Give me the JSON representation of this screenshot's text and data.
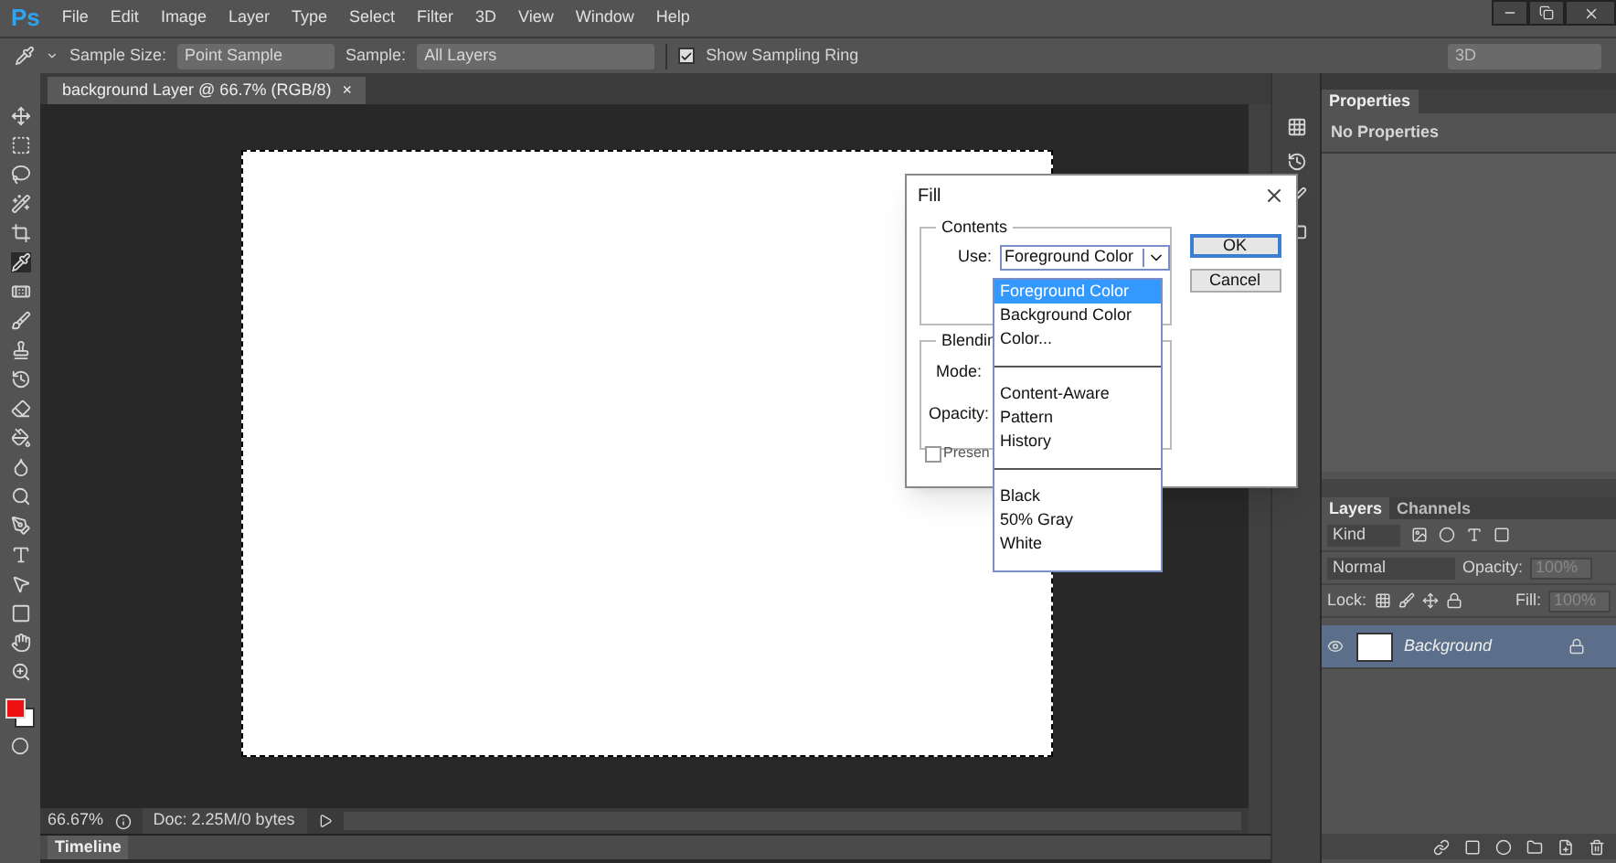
{
  "menu_bar": {
    "logo": "Ps",
    "items": [
      "File",
      "Edit",
      "Image",
      "Layer",
      "Type",
      "Select",
      "Filter",
      "3D",
      "View",
      "Window",
      "Help"
    ]
  },
  "options_bar": {
    "sample_size_label": "Sample Size:",
    "sample_size": "Point Sample",
    "sample_label": "Sample:",
    "sample": "All Layers",
    "show_sampling_ring": {
      "label": "Show Sampling Ring",
      "checked": true
    },
    "workspace": "3D"
  },
  "document": {
    "tab_title": "background Layer @ 66.7% (RGB/8)",
    "tab_close": "×"
  },
  "status_bar": {
    "zoom": "66.67%",
    "doc_info": "Doc: 2.25M/0 bytes"
  },
  "timeline": {
    "title": "Timeline"
  },
  "properties_panel": {
    "tab": "Properties",
    "message": "No Properties"
  },
  "layers_panel": {
    "tabs": [
      {
        "label": "Layers",
        "selected": true
      },
      {
        "label": "Channels",
        "selected": false
      }
    ],
    "filter": "Kind",
    "blend_mode": "Normal",
    "opacity_label": "Opacity:",
    "opacity": "100%",
    "lock_label": "Lock:",
    "fill_label": "Fill:",
    "fill": "100%",
    "layers": [
      {
        "name": "Background",
        "selected": true,
        "visible": true
      }
    ]
  },
  "fill_dialog": {
    "title": "Fill",
    "contents_group": "Contents",
    "use_label": "Use:",
    "use_value": "Foreground Color",
    "blending_group": "Blendin",
    "mode_label": "Mode:",
    "opacity_label": "Opacity:",
    "preserve": {
      "label": "Presen",
      "checked": false
    },
    "buttons": [
      "OK",
      "Cancel"
    ],
    "dropdown_groups": [
      [
        {
          "label": "Foreground Color",
          "selected": true
        },
        {
          "label": "Background Color",
          "selected": false
        },
        {
          "label": "Color...",
          "selected": false
        }
      ],
      [
        {
          "label": "Content-Aware",
          "selected": false
        },
        {
          "label": "Pattern",
          "selected": false
        },
        {
          "label": "History",
          "selected": false
        }
      ],
      [
        {
          "label": "Black",
          "selected": false
        },
        {
          "label": "50% Gray",
          "selected": false
        },
        {
          "label": "White",
          "selected": false
        }
      ]
    ]
  }
}
